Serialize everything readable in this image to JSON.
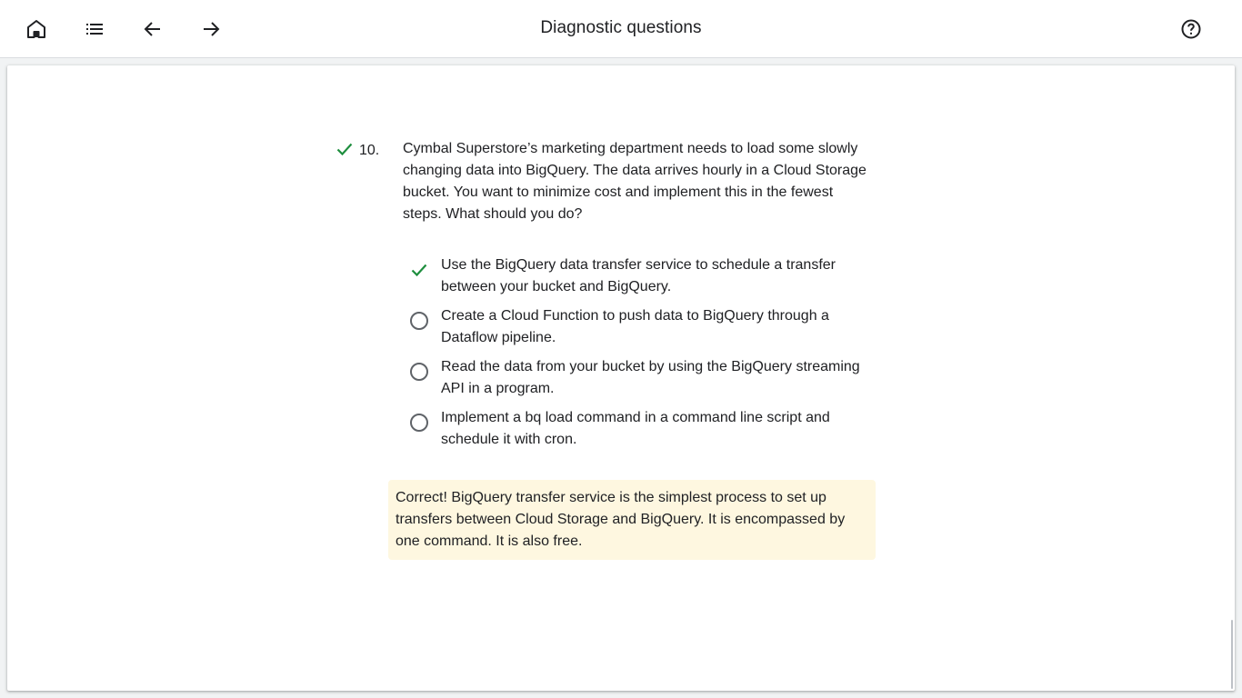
{
  "header": {
    "title": "Diagnostic questions",
    "icons": {
      "home": "home-icon",
      "list": "list-icon",
      "back": "arrow-back-icon",
      "forward": "arrow-forward-icon",
      "help": "help-icon"
    }
  },
  "question": {
    "number": "10.",
    "status_icon": "check-icon",
    "text": "Cymbal Superstore’s marketing department needs to load some slowly changing data into BigQuery. The data arrives hourly in a Cloud Storage bucket. You want to minimize cost and implement this in the fewest steps. What should you do?",
    "options": [
      {
        "text": "Use the BigQuery data transfer service to schedule a transfer between your bucket and BigQuery.",
        "state": "correct-selected"
      },
      {
        "text": "Create a Cloud Function to push data to BigQuery through a Dataflow pipeline.",
        "state": "unselected"
      },
      {
        "text": "Read the data from your bucket by using the BigQuery streaming API in a program.",
        "state": "unselected"
      },
      {
        "text": "Implement a bq load command in a command line script and schedule it with cron.",
        "state": "unselected"
      }
    ],
    "feedback": "Correct! BigQuery transfer service is the simplest process to set up transfers between Cloud Storage and BigQuery. It is encompassed by one command. It is also free."
  },
  "colors": {
    "correct_green": "#1e8e3e",
    "feedback_bg": "#fef7e0",
    "radio_border": "#5f6368"
  }
}
